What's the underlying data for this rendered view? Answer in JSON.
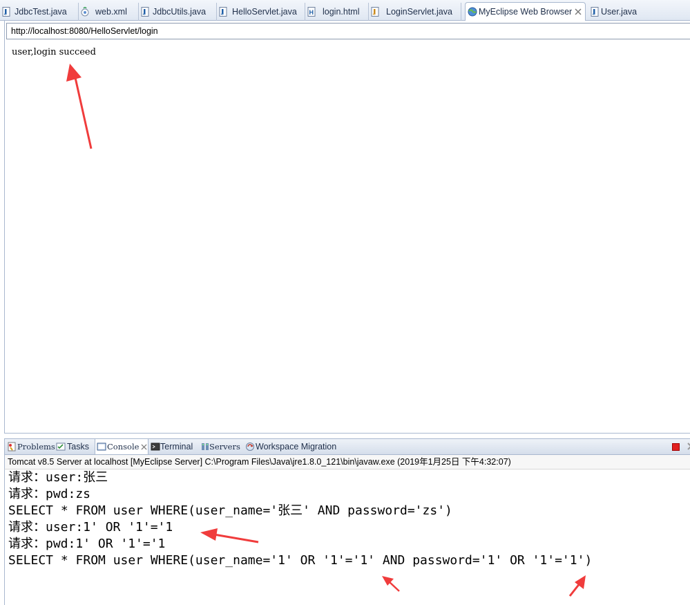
{
  "editor_tabs": [
    {
      "label": "JdbcTest.java",
      "icon": "java-file-icon"
    },
    {
      "label": "web.xml",
      "icon": "xml-file-icon"
    },
    {
      "label": "JdbcUtils.java",
      "icon": "java-file-icon"
    },
    {
      "label": "HelloServlet.java",
      "icon": "java-file-icon"
    },
    {
      "label": "login.html",
      "icon": "html-file-icon"
    },
    {
      "label": "LoginServlet.java",
      "icon": "java-file-icon"
    },
    {
      "label": "MyEclipse Web Browser",
      "icon": "globe-icon",
      "active": true
    },
    {
      "label": "User.java",
      "icon": "java-file-icon"
    }
  ],
  "browser": {
    "url": "http://localhost:8080/HelloServlet/login",
    "page_text": "user,login succeed"
  },
  "view_tabs": [
    {
      "label": "Problems",
      "icon": "problems-icon"
    },
    {
      "label": "Tasks",
      "icon": "tasks-icon"
    },
    {
      "label": "Console",
      "icon": "console-icon",
      "active": true
    },
    {
      "label": "Terminal",
      "icon": "terminal-icon"
    },
    {
      "label": "Servers",
      "icon": "servers-icon"
    },
    {
      "label": "Workspace Migration",
      "icon": "migration-icon"
    }
  ],
  "console": {
    "description": "Tomcat v8.5 Server at localhost [MyEclipse Server] C:\\Program Files\\Java\\jre1.8.0_121\\bin\\javaw.exe (2019年1月25日 下午4:32:07)",
    "lines": [
      "请求：user:张三",
      "请求：pwd:zs",
      "SELECT * FROM user WHERE(user_name='张三' AND password='zs')",
      "请求：user:1' OR '1'='1",
      "请求：pwd:1' OR '1'='1",
      "SELECT * FROM user WHERE(user_name='1' OR '1'='1' AND password='1' OR '1'='1')"
    ]
  },
  "colors": {
    "annotation_arrow": "#f03c3c",
    "tab_text": "#1f2f4a",
    "frame_border": "#a9b8cf",
    "stop_button": "#e02020"
  }
}
